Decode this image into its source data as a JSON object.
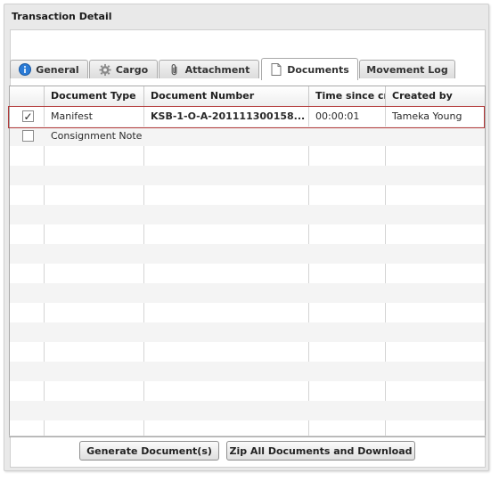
{
  "panel": {
    "title": "Transaction Detail"
  },
  "tabs": [
    {
      "label": "General",
      "icon": "info-icon"
    },
    {
      "label": "Cargo",
      "icon": "gear-icon"
    },
    {
      "label": "Attachment",
      "icon": "paperclip-icon"
    },
    {
      "label": "Documents",
      "icon": "document-icon",
      "active": true
    },
    {
      "label": "Movement Log"
    }
  ],
  "grid": {
    "columns": [
      "Document Type",
      "Document Number",
      "Time since creation",
      "Created by"
    ],
    "rows": [
      {
        "checked": true,
        "type": "Manifest",
        "number": "KSB-1-O-A-201111300158...",
        "time": "00:00:01",
        "created_by": "Tameka Young",
        "selected": true
      },
      {
        "checked": false,
        "type": "Consignment Note",
        "number": "",
        "time": "",
        "created_by": ""
      }
    ],
    "checkmark": "✓"
  },
  "buttons": {
    "generate": "Generate Document(s)",
    "zip": "Zip All Documents and Download"
  },
  "colors": {
    "selection_outline": "#b23a3a",
    "info_icon": "#2b7bd6"
  }
}
